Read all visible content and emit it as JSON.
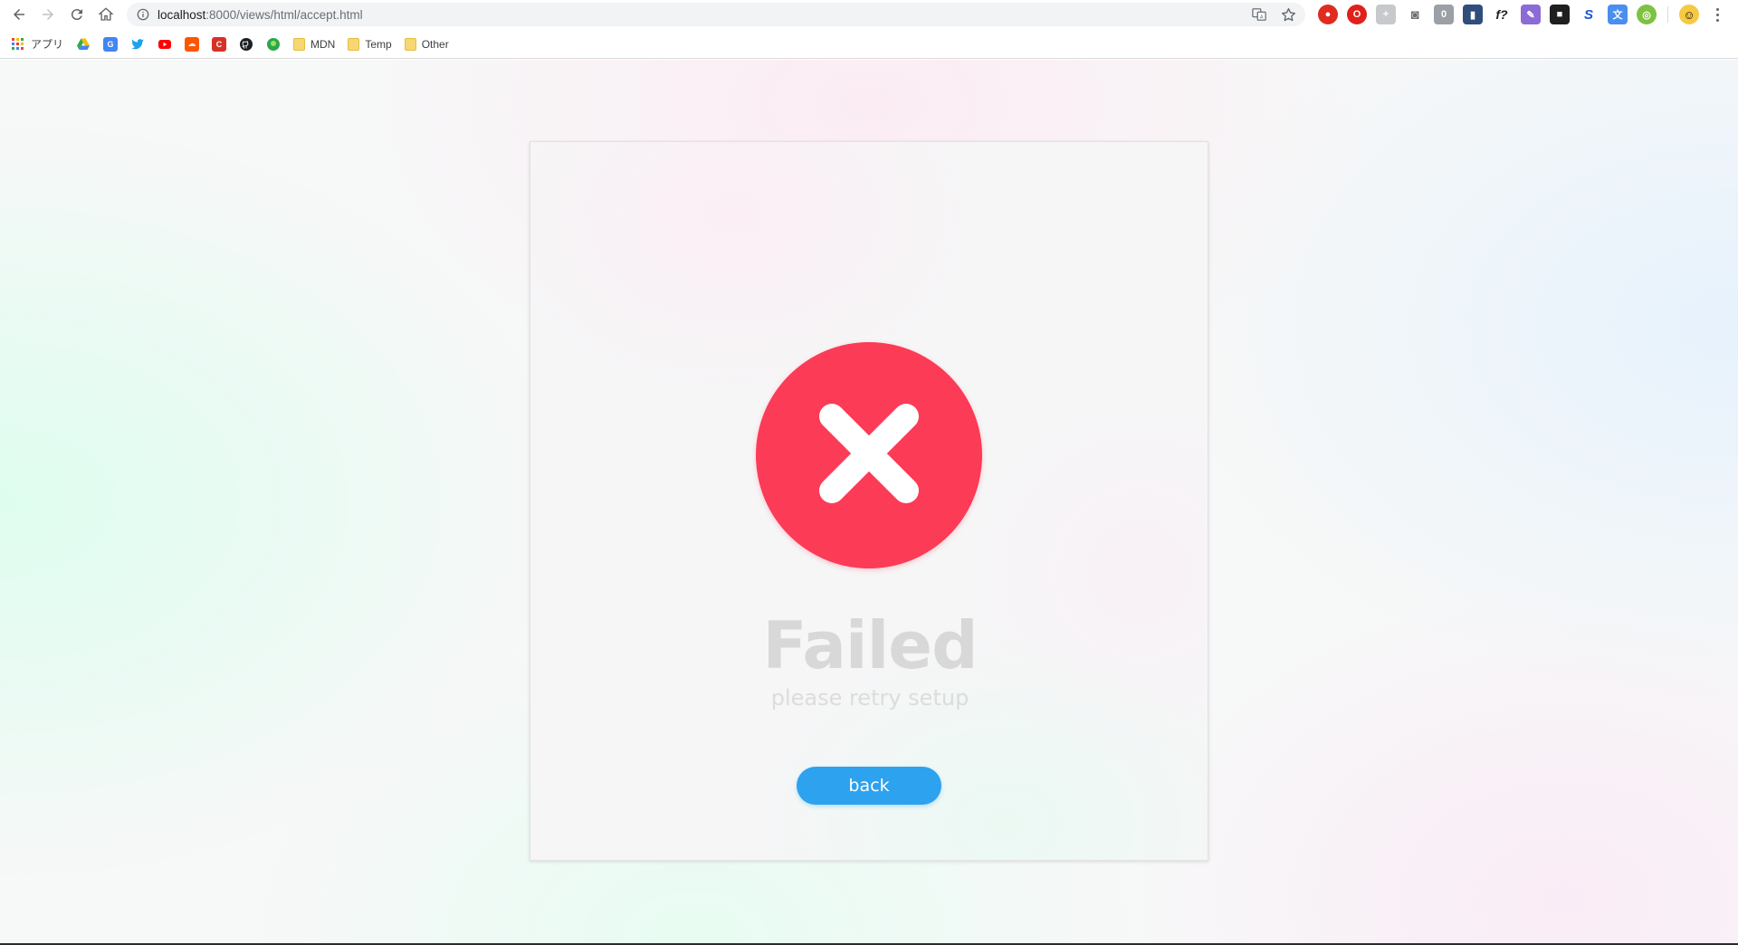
{
  "browser": {
    "url_host": "localhost",
    "url_path": ":8000/views/html/accept.html",
    "bookmarks": [
      {
        "label": "アプリ",
        "icon": "apps-grid-icon"
      },
      {
        "label": "",
        "icon": "google-drive-icon"
      },
      {
        "label": "",
        "icon": "google-translate-icon"
      },
      {
        "label": "",
        "icon": "twitter-icon"
      },
      {
        "label": "",
        "icon": "youtube-icon"
      },
      {
        "label": "",
        "icon": "soundcloud-icon"
      },
      {
        "label": "",
        "icon": "calendar-icon"
      },
      {
        "label": "",
        "icon": "github-icon"
      },
      {
        "label": "",
        "icon": "green-app-icon"
      },
      {
        "label": "MDN",
        "icon": "folder-icon"
      },
      {
        "label": "Temp",
        "icon": "folder-icon"
      },
      {
        "label": "Other",
        "icon": "folder-icon"
      }
    ]
  },
  "result": {
    "title": "Failed",
    "subtitle": "please retry setup",
    "button_label": "back",
    "icon": "x-circle-icon"
  },
  "colors": {
    "error": "#fc3b56",
    "button": "#2da2ee",
    "text_muted": "#d8d8d8"
  }
}
